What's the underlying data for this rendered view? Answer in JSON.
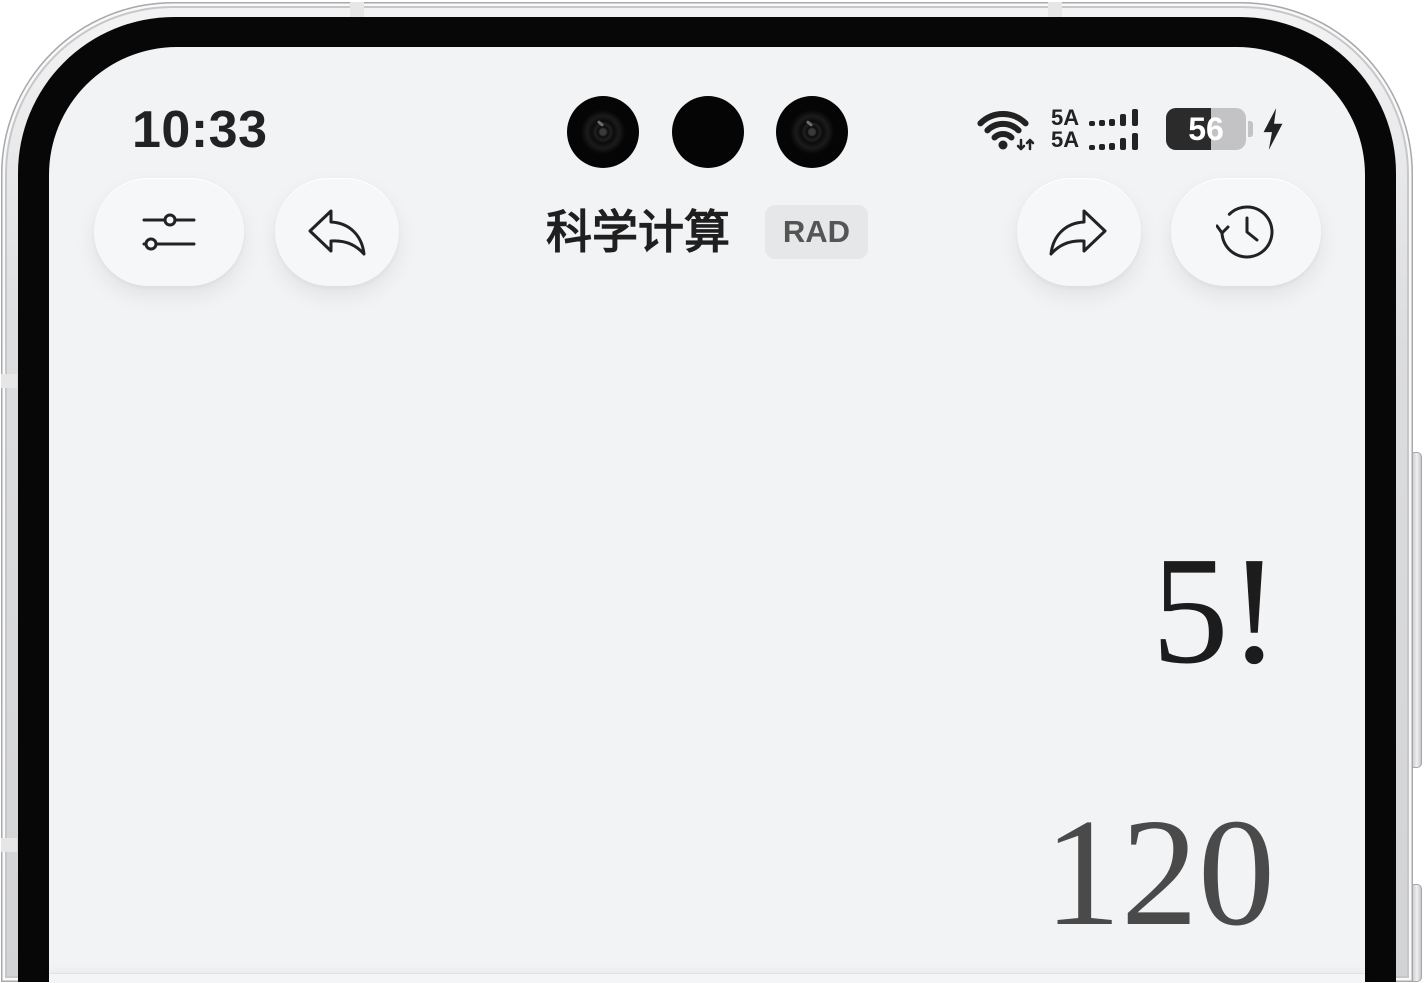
{
  "colors": {
    "screen_bg": "#f2f3f5",
    "text_primary": "#1f1f1f",
    "result_text": "#4a4a4a",
    "badge_bg": "#e6e7e9",
    "badge_text": "#555555",
    "battery_fill": "#2b2b2b"
  },
  "status_bar": {
    "time": "10:33",
    "wifi_icon": "wifi-icon",
    "sim_1_label": "5A",
    "sim_2_label": "5A",
    "signal_icon": "signal-bars-icon",
    "battery_level": "56",
    "battery_percent": 56,
    "charging": true,
    "charging_icon": "charging-bolt-icon"
  },
  "toolbar": {
    "title": "科学计算",
    "angle_mode": "RAD",
    "settings_button": {
      "icon": "sliders-icon"
    },
    "undo_button": {
      "icon": "undo-icon"
    },
    "redo_button": {
      "icon": "redo-icon"
    },
    "history_button": {
      "icon": "history-icon"
    }
  },
  "display": {
    "expression": "5!",
    "result": "120"
  }
}
